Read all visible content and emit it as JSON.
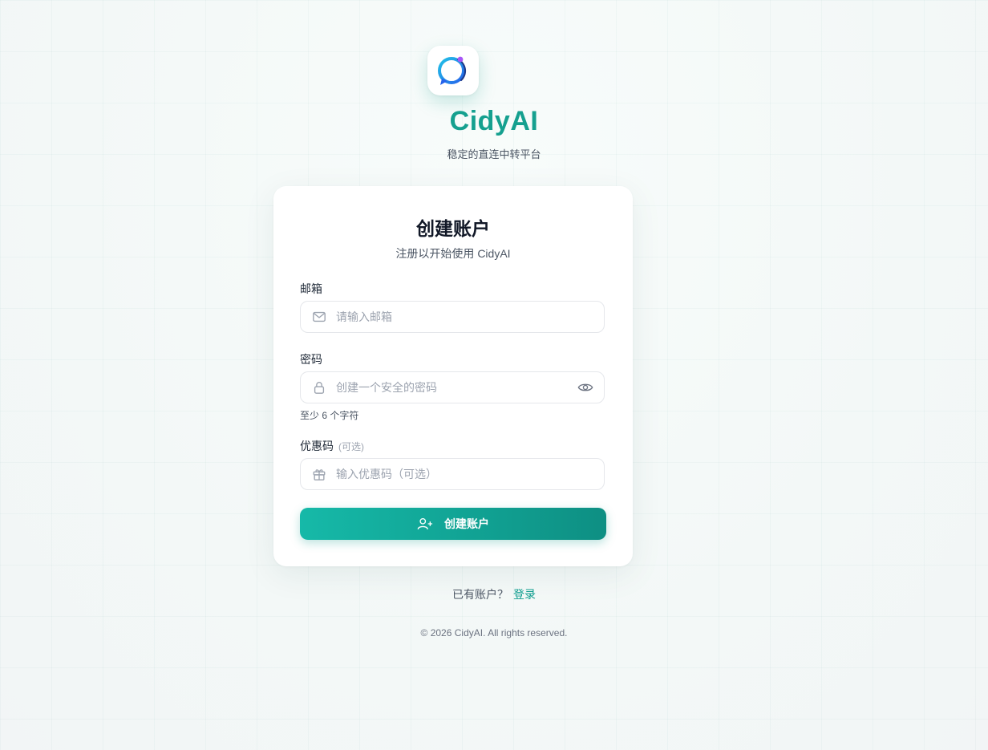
{
  "brand": {
    "name": "CidyAI",
    "tagline": "稳定的直连中转平台"
  },
  "card": {
    "title": "创建账户",
    "subtitle": "注册以开始使用 CidyAI"
  },
  "form": {
    "email": {
      "label": "邮箱",
      "value": "",
      "placeholder": "请输入邮箱",
      "icon": "mail-icon"
    },
    "password": {
      "label": "密码",
      "value": "",
      "placeholder": "创建一个安全的密码",
      "icon": "lock-icon",
      "toggle_icon": "eye-icon",
      "hint": "至少 6 个字符"
    },
    "coupon": {
      "label": "优惠码",
      "optional_tag": "(可选)",
      "value": "",
      "placeholder": "输入优惠码（可选）",
      "icon": "gift-icon"
    },
    "submit": {
      "label": "创建账户",
      "icon": "user-plus-icon"
    }
  },
  "login_prompt": {
    "text": "已有账户？",
    "link": "登录"
  },
  "footer": {
    "copyright": "© 2026 CidyAI. All rights reserved."
  },
  "colors": {
    "brand": "#15a08f",
    "button_start": "#16b9a8",
    "button_end": "#0e8f83",
    "link": "#0e9d8e",
    "background": "#f3f7f7"
  }
}
